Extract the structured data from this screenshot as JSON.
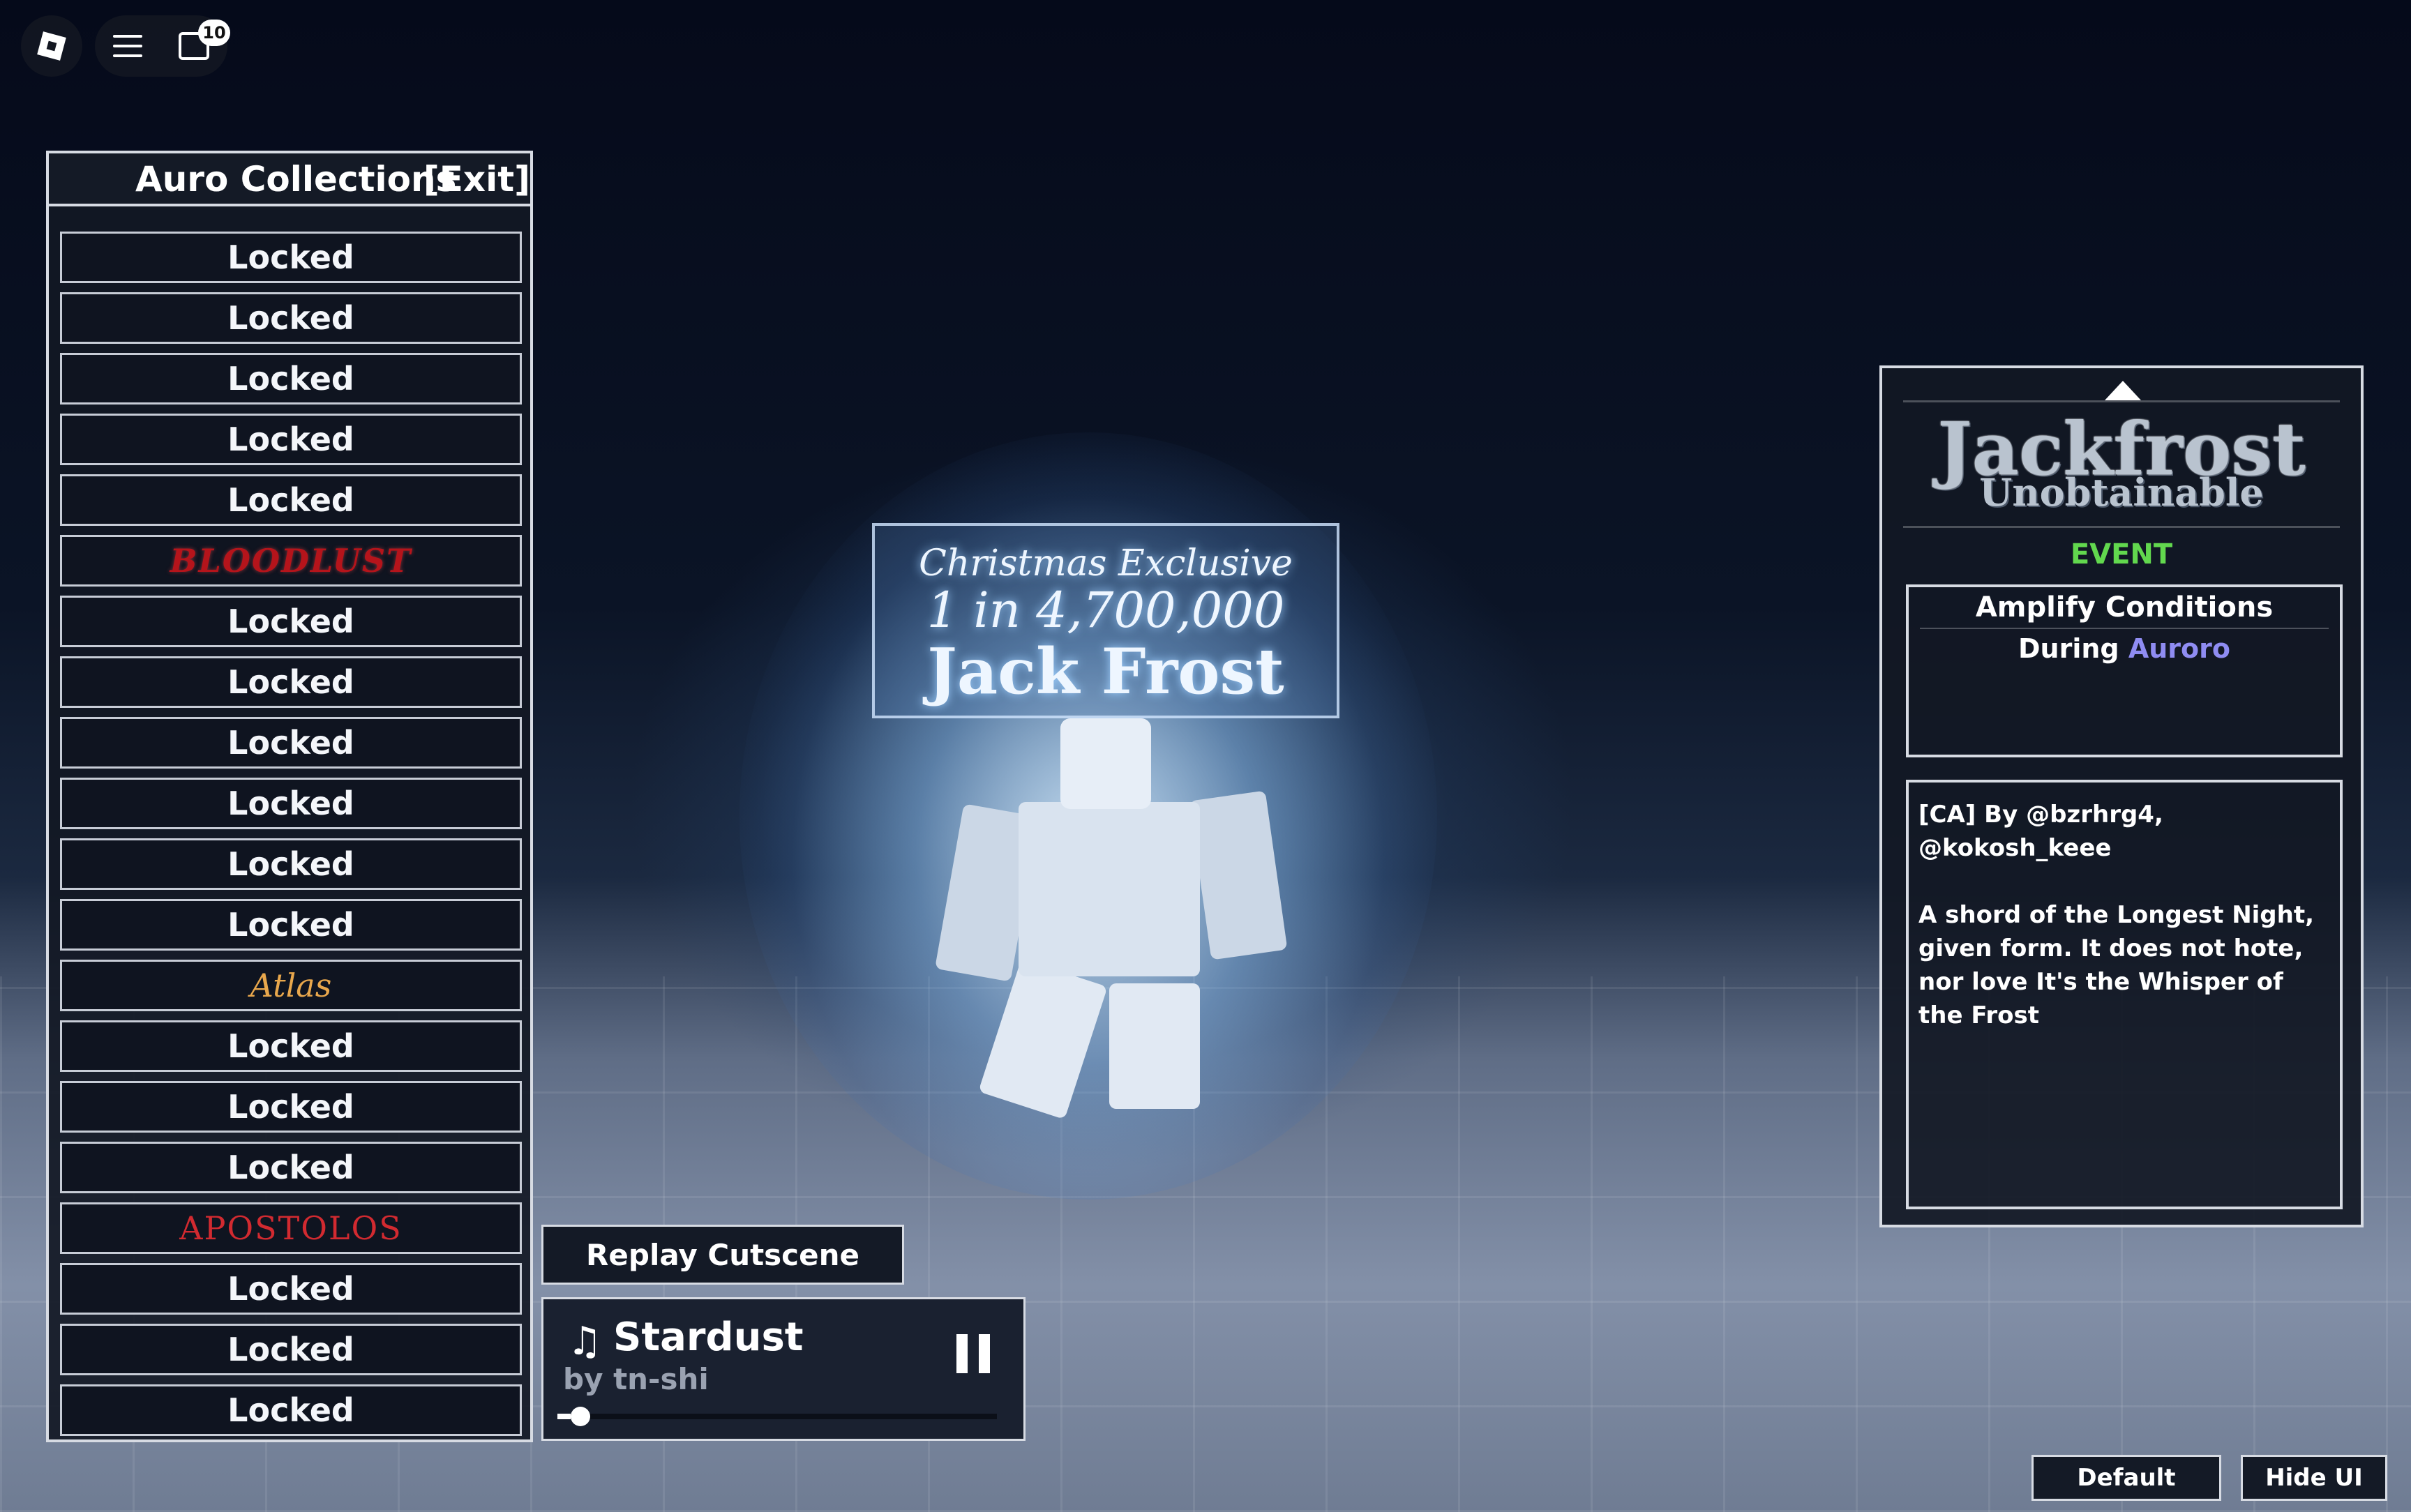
{
  "topbar": {
    "roblox_icon": "roblox-logo-icon",
    "menu_icon": "hamburger-icon",
    "chat_icon": "chat-icon",
    "chat_badge": "10"
  },
  "collection": {
    "title": "Auro Collections",
    "exit_label": "[Exit]",
    "items": [
      {
        "label": "Locked",
        "style": "plain"
      },
      {
        "label": "Locked",
        "style": "plain"
      },
      {
        "label": "Locked",
        "style": "plain"
      },
      {
        "label": "Locked",
        "style": "plain"
      },
      {
        "label": "Locked",
        "style": "plain"
      },
      {
        "label": "BLOODLUST",
        "style": "red"
      },
      {
        "label": "Locked",
        "style": "plain"
      },
      {
        "label": "Locked",
        "style": "plain"
      },
      {
        "label": "Locked",
        "style": "plain"
      },
      {
        "label": "Locked",
        "style": "plain"
      },
      {
        "label": "Locked",
        "style": "plain"
      },
      {
        "label": "Locked",
        "style": "plain"
      },
      {
        "label": "Atlas",
        "style": "gold"
      },
      {
        "label": "Locked",
        "style": "plain"
      },
      {
        "label": "Locked",
        "style": "plain"
      },
      {
        "label": "Locked",
        "style": "plain"
      },
      {
        "label": "APOSTOLOS",
        "style": "redserif"
      },
      {
        "label": "Locked",
        "style": "plain"
      },
      {
        "label": "Locked",
        "style": "plain"
      },
      {
        "label": "Locked",
        "style": "plain"
      },
      {
        "label": "Locked",
        "style": "plain"
      }
    ]
  },
  "showcase": {
    "sign_line1": "Christmas Exclusive",
    "sign_line2": "1 in 4,700,000",
    "sign_line3": "Jack Frost"
  },
  "info": {
    "aura_name": "Jackfrost",
    "rarity": "Unobtainable",
    "category": "EVENT",
    "category_color": "#62d84e",
    "conditions_title": "Amplify Conditions",
    "conditions_prefix": "During",
    "conditions_value": "Auroro",
    "conditions_accent": "#8f8cf2",
    "description": "[CA] By @bzrhrg4,\n@kokosh_keee\n\nA shord of the Longest Night, given form. It does not hote, nor love It's the Whisper of the Frost"
  },
  "replay_label": "Replay Cutscene",
  "music": {
    "title": "Stardust",
    "artist": "by tn-shi",
    "progress": 0.03
  },
  "buttons": {
    "default_label": "Default",
    "hide_label": "Hide UI"
  }
}
